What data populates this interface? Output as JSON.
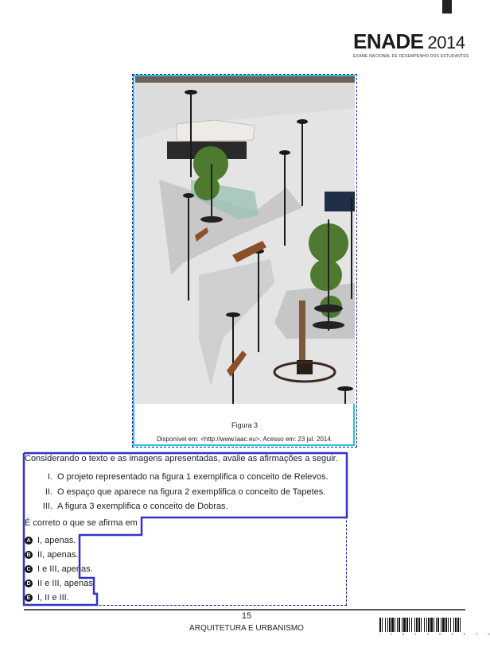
{
  "header": {
    "logo_main": "ENADE",
    "logo_year": "2014",
    "logo_subtitle": "EXAME NACIONAL DE DESEMPENHO DOS ESTUDANTES"
  },
  "figure": {
    "title": "Figura 3",
    "source": "Disponível em: <http://www.laac.eu>. Acesso em: 23 jul. 2014."
  },
  "question": {
    "prompt": "Considerando o texto e as imagens apresentadas, avalie as afirmações a seguir.",
    "statements": [
      {
        "num": "I.",
        "text": "O projeto representado na figura 1 exemplifica o conceito de Relevos."
      },
      {
        "num": "II.",
        "text": "O espaço que aparece na figura 2 exemplifica o conceito de Tapetes."
      },
      {
        "num": "III.",
        "text": "A figura 3 exemplifica o conceito de Dobras."
      }
    ],
    "ask": "É correto o que se afirma em",
    "options": [
      {
        "letter": "A",
        "text": "I, apenas."
      },
      {
        "letter": "B",
        "text": "II, apenas."
      },
      {
        "letter": "C",
        "text": "I e III, apenas."
      },
      {
        "letter": "D",
        "text": "II e III, apenas."
      },
      {
        "letter": "E",
        "text": "I, II e III."
      }
    ]
  },
  "footer": {
    "page_number": "15",
    "course": "ARQUITETURA E URBANISMO",
    "barcode_digits": "* 2 0 1 2 0 3 5 1 5 *"
  },
  "colors": {
    "figure_border": "#1ec8d8",
    "selection_outline": "#3333cc"
  }
}
